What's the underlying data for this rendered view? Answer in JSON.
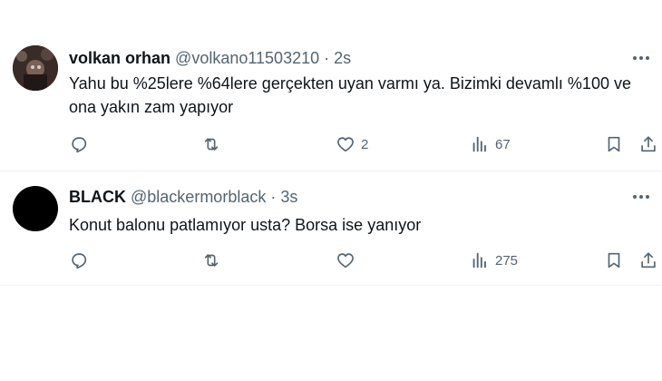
{
  "tweets": [
    {
      "name": "volkan orhan",
      "handle": "@volkano11503210",
      "separator": "·",
      "time": "2s",
      "text": "Yahu bu %25lere %64lere gerçekten uyan varmı ya. Bizimki devamlı %100 ve ona yakın zam yapıyor",
      "reply_count": "",
      "retweet_count": "",
      "like_count": "2",
      "view_count": "67"
    },
    {
      "name": "BLACK",
      "handle": "@blackermorblack",
      "separator": "·",
      "time": "3s",
      "text": "Konut balonu patlamıyor usta? Borsa ise yanıyor",
      "reply_count": "",
      "retweet_count": "",
      "like_count": "",
      "view_count": "275"
    }
  ],
  "icons": {
    "reply": "reply-icon",
    "retweet": "retweet-icon",
    "like": "heart-icon",
    "views": "views-icon",
    "bookmark": "bookmark-icon",
    "share": "share-icon",
    "more": "more-icon"
  },
  "colors": {
    "text_primary": "#0f1419",
    "text_secondary": "#536471",
    "divider": "#eff3f4"
  }
}
